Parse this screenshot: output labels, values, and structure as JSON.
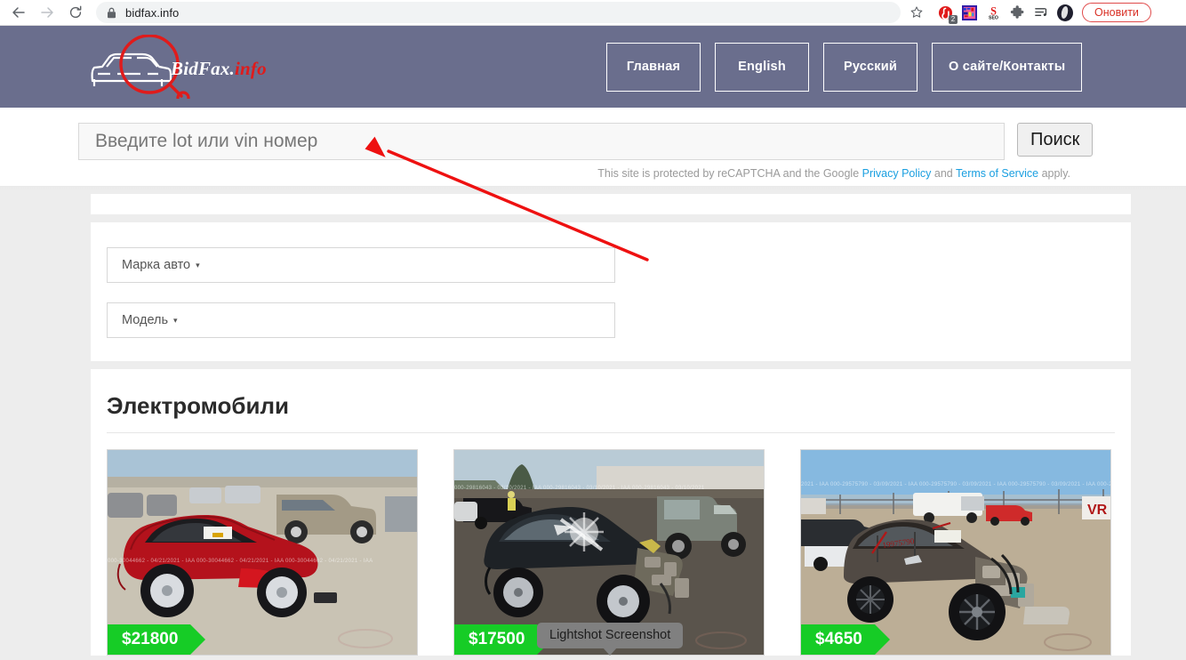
{
  "browser": {
    "back_icon": "back-arrow-icon",
    "forward_icon": "forward-arrow-icon",
    "reload_icon": "reload-icon",
    "lock_icon": "lock-icon",
    "url": "bidfax.info",
    "bookmark_icon": "star-icon",
    "extensions": [
      {
        "name": "adblock-extension-icon",
        "badge": "2"
      },
      {
        "name": "colorful-square-extension-icon",
        "badge": ""
      },
      {
        "name": "seo-extension-icon",
        "badge": ""
      },
      {
        "name": "puzzle-extensions-icon",
        "badge": ""
      },
      {
        "name": "playlist-music-icon",
        "badge": ""
      }
    ],
    "avatar_name": "profile-avatar",
    "update_label": "Оновити"
  },
  "site": {
    "logo_white": "BidFax.",
    "logo_red": "info",
    "nav": [
      {
        "label": "Главная"
      },
      {
        "label": "English"
      },
      {
        "label": "Русский"
      },
      {
        "label": "О сайте/Контакты"
      }
    ]
  },
  "search": {
    "placeholder": "Введите lot или vin номер",
    "value": "",
    "button_label": "Поиск",
    "recaptcha_prefix": "This site is protected by reCAPTCHA and the Google ",
    "privacy_link": "Privacy Policy",
    "recaptcha_mid": " and ",
    "terms_link": "Terms of Service",
    "recaptcha_suffix": " apply."
  },
  "filters": {
    "make": {
      "label": "Марка авто",
      "caret": "▾"
    },
    "model": {
      "label": "Модель",
      "caret": "▾"
    }
  },
  "cars_section": {
    "title": "Электромобили",
    "cards": [
      {
        "price": "$21800",
        "alt": "red-tesla-model-s",
        "watermark": "000-30044662 - 04/21/2021 - IAA     000-30044662 - 04/21/2021 - IAA     000-30044662 - 04/21/2021 - IAA"
      },
      {
        "price": "$17500",
        "alt": "damaged-dark-tesla-model-3",
        "watermark": "000-29816043 - 03/10/2021 - IAA     000-29816043 - 03/10/2021 - IAA     000-29816043 - 03/10/2021"
      },
      {
        "price": "$4650",
        "alt": "damaged-bmw-i3",
        "watermark": "2021 - IAA     000-29575790 - 03/09/2021 - IAA     000-29575790 - 03/09/2021 - IAA     000-29575790 - 03/09/2021 - IAA     000-2957579"
      }
    ]
  },
  "overlay": {
    "lightshot_tooltip": "Lightshot Screenshot",
    "arrow_color": "#ee1111"
  }
}
